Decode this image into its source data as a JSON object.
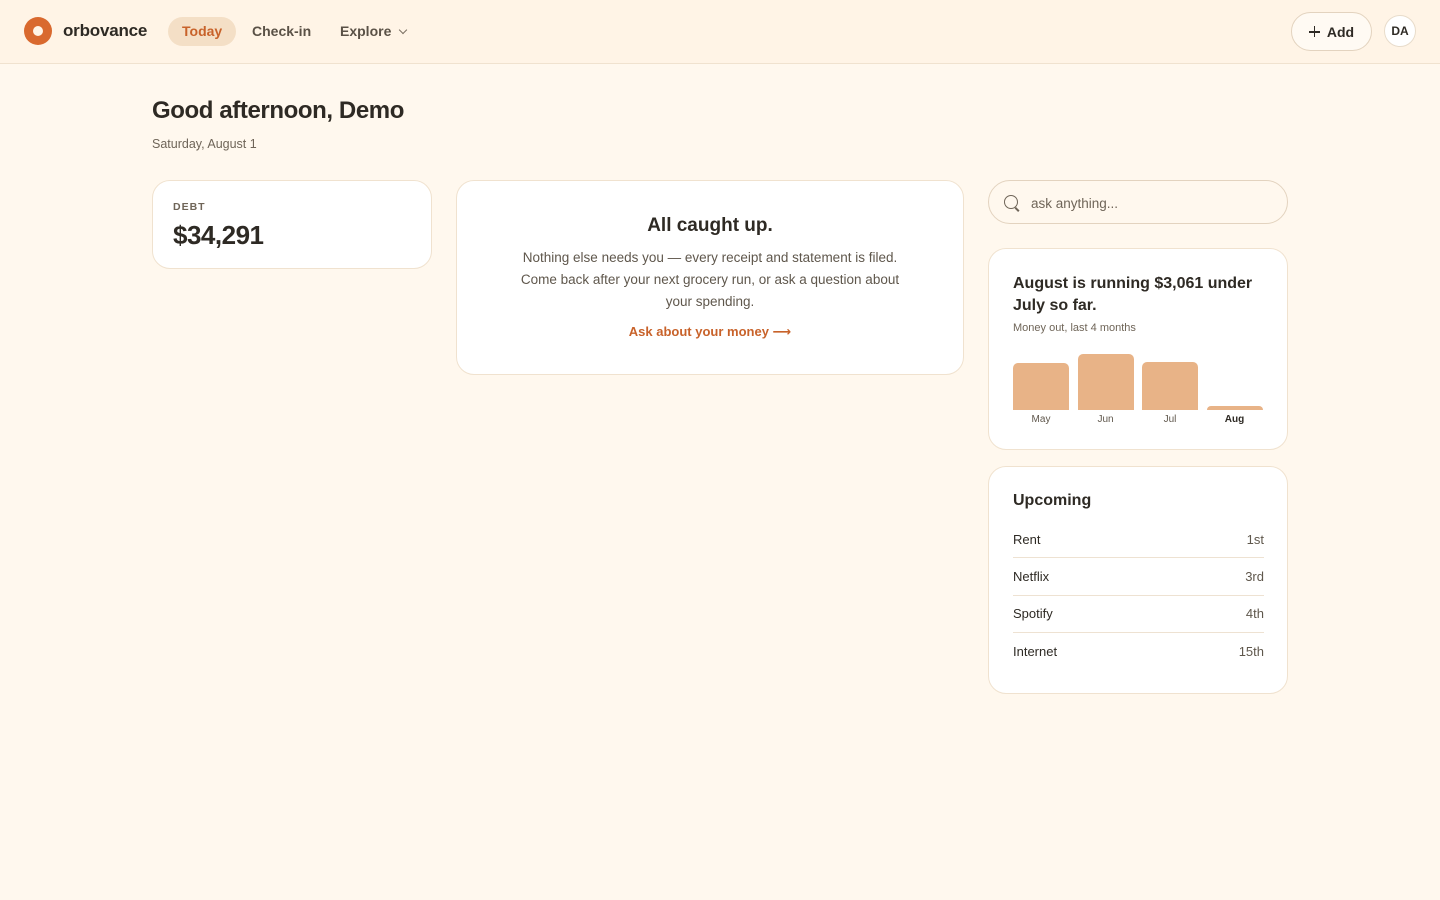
{
  "header": {
    "brand": "orbovance",
    "nav": [
      {
        "label": "Today",
        "active": true
      },
      {
        "label": "Check-in",
        "active": false
      },
      {
        "label": "Explore",
        "active": false
      }
    ],
    "add_label": "Add",
    "avatar_initials": "DA"
  },
  "greeting": {
    "title": "Good afternoon, Demo",
    "date": "Saturday, August 1"
  },
  "debt": {
    "label": "DEBT",
    "value": "$34,291"
  },
  "caught_up": {
    "title": "All caught up.",
    "body": "Nothing else needs you — every receipt and statement is filed. Come back after your next grocery run, or ask a question about your spending.",
    "link": "Ask about your money ⟶"
  },
  "search": {
    "placeholder": "ask anything..."
  },
  "spending": {
    "headline": "August is running $3,061 under July so far.",
    "subtitle": "Money out, last 4 months"
  },
  "chart_data": {
    "type": "bar",
    "categories": [
      "May",
      "Jun",
      "Jul",
      "Aug"
    ],
    "values": [
      3000,
      3600,
      3100,
      250
    ],
    "highlight": "Aug",
    "color": "#e8b387"
  },
  "upcoming": {
    "title": "Upcoming",
    "items": [
      {
        "name": "Rent",
        "date": "1st"
      },
      {
        "name": "Netflix",
        "date": "3rd"
      },
      {
        "name": "Spotify",
        "date": "4th"
      },
      {
        "name": "Internet",
        "date": "15th"
      }
    ]
  },
  "colors": {
    "accent": "#c8622a",
    "background": "#fff8ee",
    "bar": "#e8b387"
  }
}
